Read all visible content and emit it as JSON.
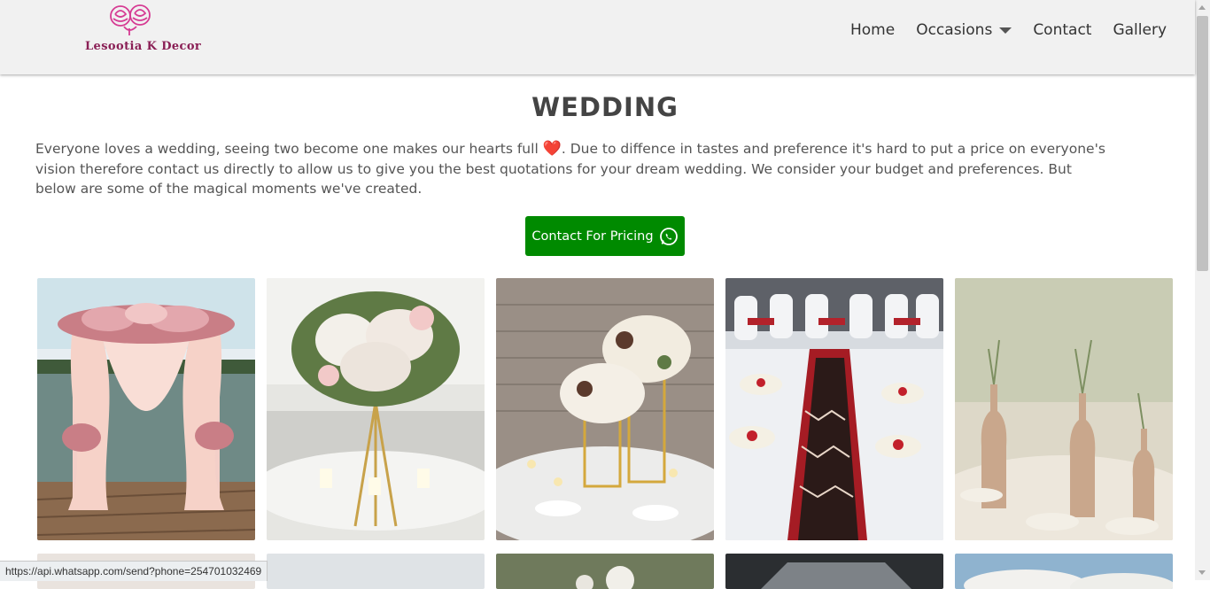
{
  "brand": {
    "name": "Lesootia K Decor",
    "logo_icon": "roses-logo-icon",
    "accent": "#d63b93"
  },
  "nav": {
    "home": "Home",
    "occasions": "Occasions",
    "contact": "Contact",
    "gallery": "Gallery"
  },
  "page": {
    "title": "WEDDING",
    "intro_part1": "Everyone loves a wedding, seeing two become one makes our hearts full ",
    "intro_heart": "❤️",
    "intro_part2": ". Due to diffence in tastes and preference it's hard to put a price on everyone's vision therefore contact us directly to allow us to give you the best quotations for your dream wedding. We consider your budget and preferences. But below are some of the magical moments we've created."
  },
  "cta": {
    "label": "Contact For Pricing",
    "icon": "whatsapp-icon",
    "color": "#008a00"
  },
  "gallery": {
    "row1": [
      {
        "name": "gallery-image-pink-floral-arch"
      },
      {
        "name": "gallery-image-tall-floral-centerpiece"
      },
      {
        "name": "gallery-image-gold-stand-centerpiece"
      },
      {
        "name": "gallery-image-red-table-runner"
      },
      {
        "name": "gallery-image-bottle-vases"
      }
    ]
  },
  "status_bar": {
    "url": "https://api.whatsapp.com/send?phone=254701032469"
  }
}
